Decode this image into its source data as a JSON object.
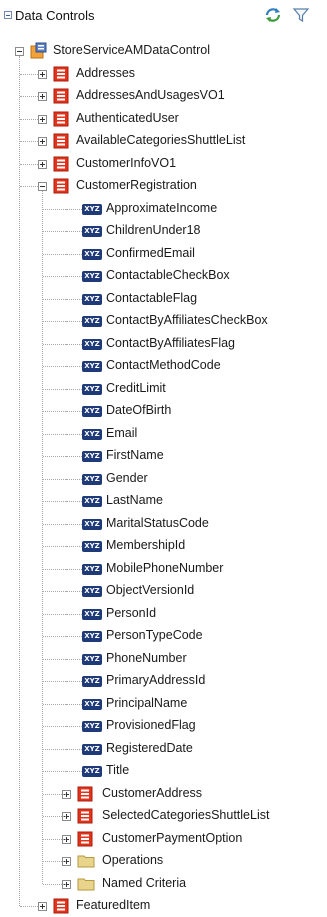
{
  "header": {
    "title": "Data Controls"
  },
  "root": {
    "label": "StoreServiceAMDataControl"
  },
  "collections_top": [
    "Addresses",
    "AddressesAndUsagesVO1",
    "AuthenticatedUser",
    "AvailableCategoriesShuttleList",
    "CustomerInfoVO1"
  ],
  "expanded": {
    "label": "CustomerRegistration",
    "attribute_icon_text": "XYZ",
    "attributes": [
      "ApproximateIncome",
      "ChildrenUnder18",
      "ConfirmedEmail",
      "ContactableCheckBox",
      "ContactableFlag",
      "ContactByAffiliatesCheckBox",
      "ContactByAffiliatesFlag",
      "ContactMethodCode",
      "CreditLimit",
      "DateOfBirth",
      "Email",
      "FirstName",
      "Gender",
      "LastName",
      "MaritalStatusCode",
      "MembershipId",
      "MobilePhoneNumber",
      "ObjectVersionId",
      "PersonId",
      "PersonTypeCode",
      "PhoneNumber",
      "PrimaryAddressId",
      "PrincipalName",
      "ProvisionedFlag",
      "RegisteredDate",
      "Title"
    ],
    "children": [
      {
        "label": "CustomerAddress",
        "kind": "collection"
      },
      {
        "label": "SelectedCategoriesShuttleList",
        "kind": "collection"
      },
      {
        "label": "CustomerPaymentOption",
        "kind": "collection"
      },
      {
        "label": "Operations",
        "kind": "folder"
      },
      {
        "label": "Named Criteria",
        "kind": "folder"
      }
    ]
  },
  "collections_bottom": [
    "FeaturedItem"
  ],
  "colors": {
    "collection_icon": "#e4331b",
    "folder_icon": "#e8d48a",
    "attribute_icon": "#1e3a78"
  }
}
